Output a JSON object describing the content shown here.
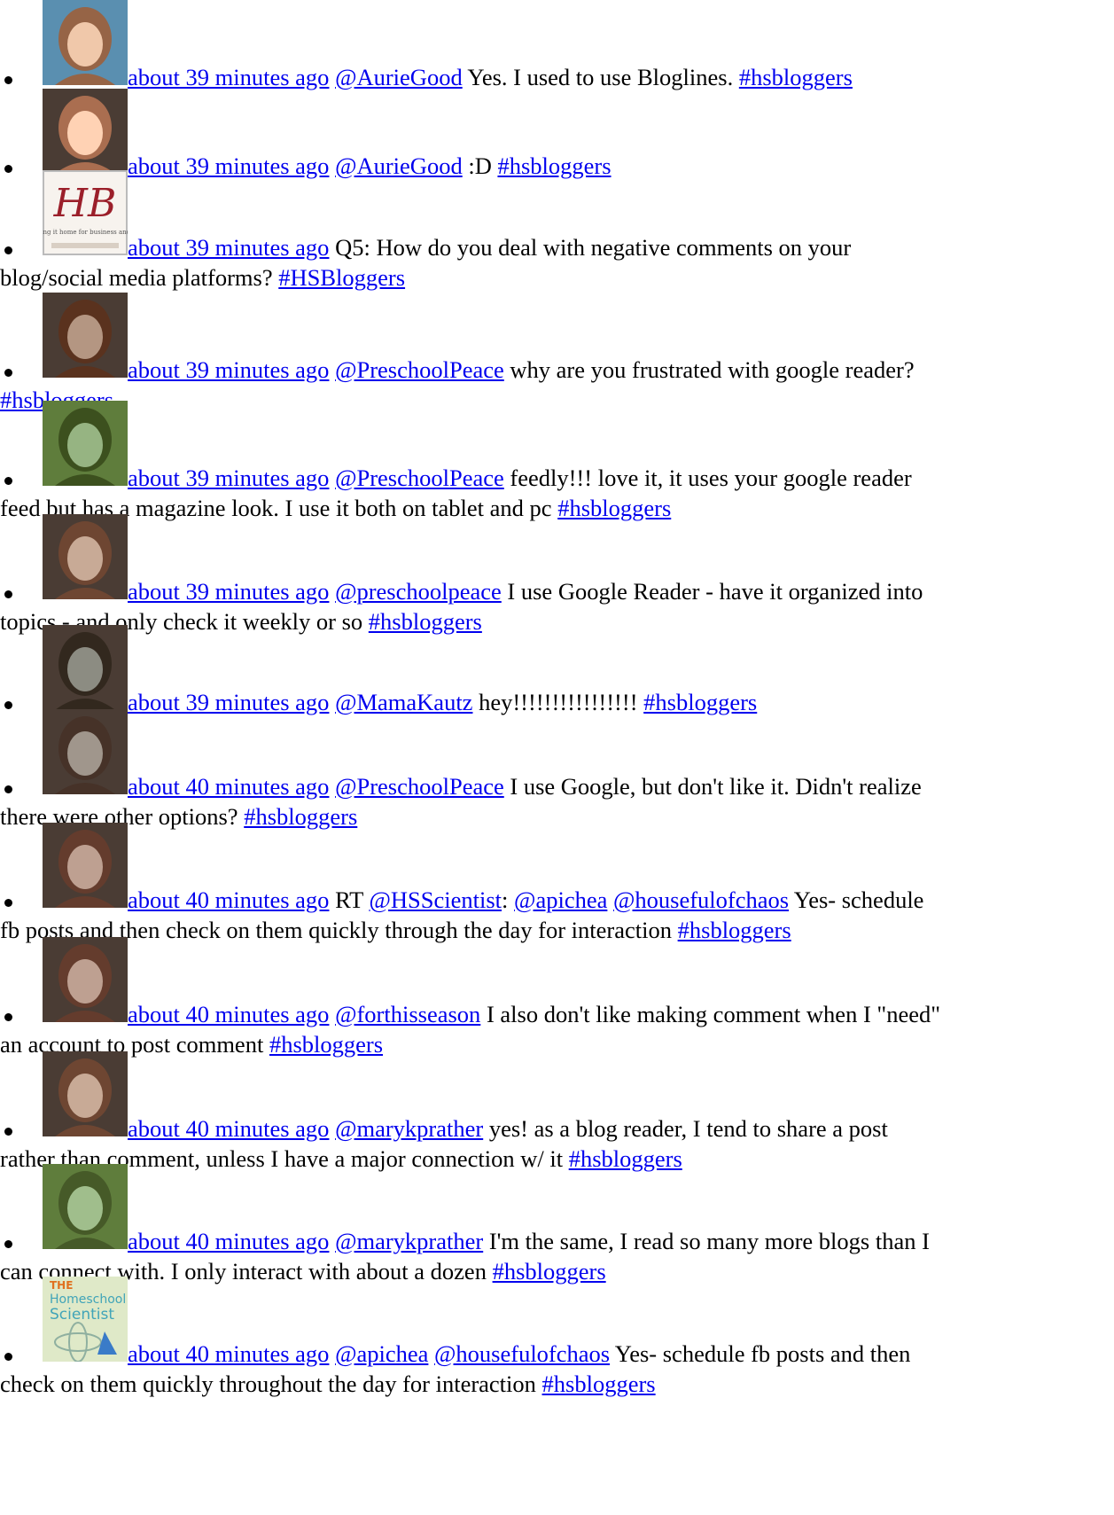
{
  "tweets": [
    {
      "avatar": "woman-portrait-avatar",
      "time": "about 39 minutes ago",
      "parts": [
        {
          "t": "link",
          "v": "@AurieGood"
        },
        {
          "t": "text",
          "v": " Yes. I used to use Bloglines. "
        },
        {
          "t": "link",
          "v": "#hsbloggers"
        }
      ]
    },
    {
      "avatar": "woman-portrait-avatar",
      "time": "about 39 minutes ago",
      "parts": [
        {
          "t": "link",
          "v": "@AurieGood"
        },
        {
          "t": "text",
          "v": " :D "
        },
        {
          "t": "link",
          "v": "#hsbloggers"
        }
      ]
    },
    {
      "avatar": "hb-logo-avatar",
      "time": "about 39 minutes ago",
      "parts": [
        {
          "t": "text",
          "v": " Q5: How do you deal with negative comments on your "
        },
        {
          "t": "br"
        },
        {
          "t": "text",
          "v": "blog/social media platforms? "
        },
        {
          "t": "link",
          "v": "#HSBloggers"
        }
      ]
    },
    {
      "avatar": "woman-portrait-avatar",
      "time": "about 39 minutes ago",
      "parts": [
        {
          "t": "link",
          "v": "@PreschoolPeace"
        },
        {
          "t": "text",
          "v": " why are you frustrated with google reader?"
        },
        {
          "t": "br"
        },
        {
          "t": "link",
          "v": "#hsbloggers"
        }
      ]
    },
    {
      "avatar": "woman-portrait-avatar",
      "time": "about 39 minutes ago",
      "parts": [
        {
          "t": "link",
          "v": "@PreschoolPeace"
        },
        {
          "t": "text",
          "v": " feedly!!! love it, it uses your google reader"
        },
        {
          "t": "br"
        },
        {
          "t": "text",
          "v": "feed but has a magazine look. I use it both on tablet and pc "
        },
        {
          "t": "link",
          "v": "#hsbloggers"
        }
      ]
    },
    {
      "avatar": "woman-portrait-avatar",
      "time": "about 39 minutes ago",
      "parts": [
        {
          "t": "link",
          "v": "@preschoolpeace"
        },
        {
          "t": "text",
          "v": " I use Google Reader - have it organized into"
        },
        {
          "t": "br"
        },
        {
          "t": "text",
          "v": "topics - and only check it weekly or so "
        },
        {
          "t": "link",
          "v": "#hsbloggers"
        }
      ]
    },
    {
      "avatar": "woman-portrait-avatar",
      "time": "about 39 minutes ago",
      "parts": [
        {
          "t": "link",
          "v": "@MamaKautz"
        },
        {
          "t": "text",
          "v": " hey!!!!!!!!!!!!!!!! "
        },
        {
          "t": "link",
          "v": "#hsbloggers"
        }
      ]
    },
    {
      "avatar": "woman-portrait-avatar",
      "time": "about 40 minutes ago",
      "parts": [
        {
          "t": "link",
          "v": "@PreschoolPeace"
        },
        {
          "t": "text",
          "v": " I use Google, but don't like it. Didn't realize"
        },
        {
          "t": "br"
        },
        {
          "t": "text",
          "v": "there were other options? "
        },
        {
          "t": "link",
          "v": "#hsbloggers"
        }
      ]
    },
    {
      "avatar": "woman-portrait-avatar",
      "time": "about 40 minutes ago",
      "parts": [
        {
          "t": "text",
          "v": " RT "
        },
        {
          "t": "link",
          "v": "@HSScientist"
        },
        {
          "t": "text",
          "v": ": "
        },
        {
          "t": "link",
          "v": "@apichea"
        },
        {
          "t": "text",
          "v": " "
        },
        {
          "t": "link",
          "v": "@housefulofchaos"
        },
        {
          "t": "text",
          "v": " Yes- schedule"
        },
        {
          "t": "br"
        },
        {
          "t": "text",
          "v": "fb posts and then check on them quickly through the day for interaction "
        },
        {
          "t": "link",
          "v": "#hsbloggers"
        }
      ]
    },
    {
      "avatar": "woman-portrait-avatar",
      "time": "about 40 minutes ago",
      "parts": [
        {
          "t": "link",
          "v": "@forthisseason"
        },
        {
          "t": "text",
          "v": " I also don't like making comment when I \"need\""
        },
        {
          "t": "br"
        },
        {
          "t": "text",
          "v": "an account to post comment "
        },
        {
          "t": "link",
          "v": "#hsbloggers"
        }
      ]
    },
    {
      "avatar": "woman-portrait-avatar",
      "time": "about 40 minutes ago",
      "parts": [
        {
          "t": "link",
          "v": "@marykprather"
        },
        {
          "t": "text",
          "v": " yes! as a blog reader, I tend to share a post"
        },
        {
          "t": "br"
        },
        {
          "t": "text",
          "v": "rather than comment, unless I have a major connection w/ it "
        },
        {
          "t": "link",
          "v": "#hsbloggers"
        }
      ]
    },
    {
      "avatar": "woman-portrait-avatar",
      "time": "about 40 minutes ago",
      "parts": [
        {
          "t": "link",
          "v": "@marykprather"
        },
        {
          "t": "text",
          "v": " I'm the same, I read so many more blogs than I"
        },
        {
          "t": "br"
        },
        {
          "t": "text",
          "v": "can connect with. I only interact with about a dozen "
        },
        {
          "t": "link",
          "v": "#hsbloggers"
        }
      ]
    },
    {
      "avatar": "homeschool-scientist-logo-avatar",
      "avatar_text": [
        "THE",
        "Homeschool",
        "Scientist"
      ],
      "time": "about 40 minutes ago",
      "parts": [
        {
          "t": "link",
          "v": "@apichea"
        },
        {
          "t": "text",
          "v": " "
        },
        {
          "t": "link",
          "v": "@housefulofchaos"
        },
        {
          "t": "text",
          "v": " Yes- schedule fb posts and then"
        },
        {
          "t": "br"
        },
        {
          "t": "text",
          "v": "check on them quickly throughout the day for interaction "
        },
        {
          "t": "link",
          "v": "#hsbloggers"
        }
      ]
    }
  ],
  "hb_logo": {
    "letters": "HB",
    "tagline": "bringing it home for business and blog"
  },
  "colors": {
    "link": "#0000ee",
    "text": "#000000"
  }
}
